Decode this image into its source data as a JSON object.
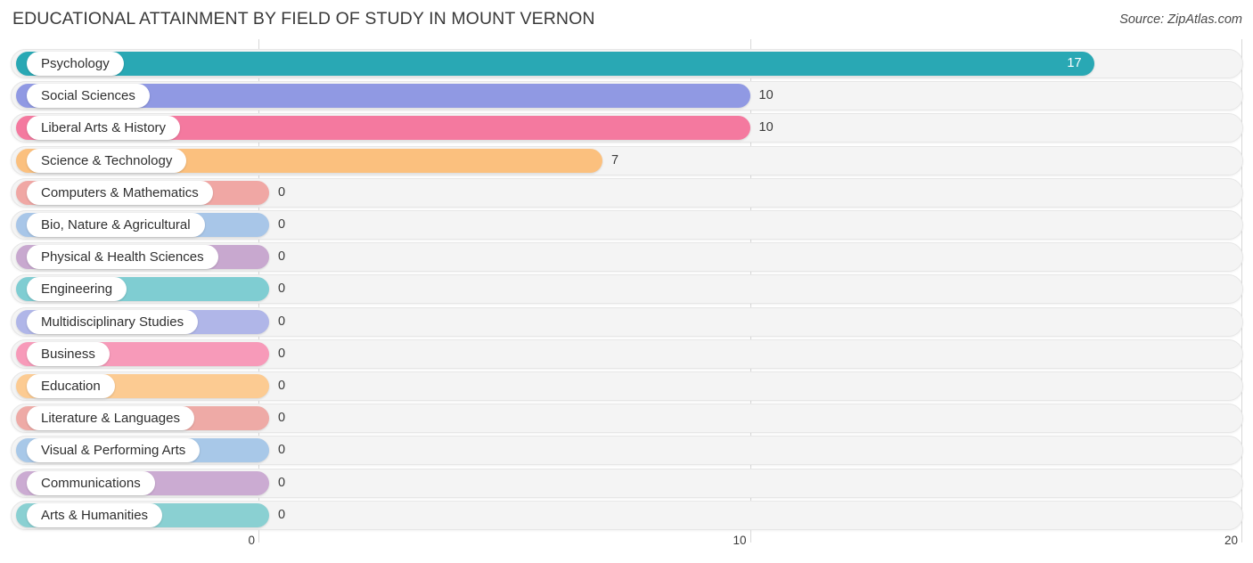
{
  "header": {
    "title": "EDUCATIONAL ATTAINMENT BY FIELD OF STUDY IN MOUNT VERNON",
    "source": "Source: ZipAtlas.com"
  },
  "chart_data": {
    "type": "bar",
    "orientation": "horizontal",
    "title": "EDUCATIONAL ATTAINMENT BY FIELD OF STUDY IN MOUNT VERNON",
    "subtitle": "",
    "xlabel": "",
    "ylabel": "",
    "xlim": [
      0,
      20
    ],
    "xticks": [
      0,
      10,
      20
    ],
    "xticklabels": [
      "0",
      "10",
      "20"
    ],
    "grid": true,
    "legend": false,
    "categories": [
      "Psychology",
      "Social Sciences",
      "Liberal Arts & History",
      "Science & Technology",
      "Computers & Mathematics",
      "Bio, Nature & Agricultural",
      "Physical & Health Sciences",
      "Engineering",
      "Multidisciplinary Studies",
      "Business",
      "Education",
      "Literature & Languages",
      "Visual & Performing Arts",
      "Communications",
      "Arts & Humanities"
    ],
    "values": [
      17,
      10,
      10,
      7,
      0,
      0,
      0,
      0,
      0,
      0,
      0,
      0,
      0,
      0,
      0
    ],
    "value_labels": [
      "17",
      "10",
      "10",
      "7",
      "0",
      "0",
      "0",
      "0",
      "0",
      "0",
      "0",
      "0",
      "0",
      "0",
      "0"
    ],
    "colors": [
      "#29a8b4",
      "#9099e3",
      "#f4799f",
      "#fbc07e",
      "#f0a7a4",
      "#a8c6e8",
      "#c8a8cf",
      "#7fcdd2",
      "#b0b6e8",
      "#f79ab9",
      "#fccb92",
      "#eeaaa6",
      "#a8c8e8",
      "#cbabd2",
      "#8ad0d2"
    ]
  },
  "axis": {
    "ticks": [
      {
        "label": "0",
        "value": 0
      },
      {
        "label": "10",
        "value": 10
      },
      {
        "label": "20",
        "value": 20
      }
    ]
  }
}
